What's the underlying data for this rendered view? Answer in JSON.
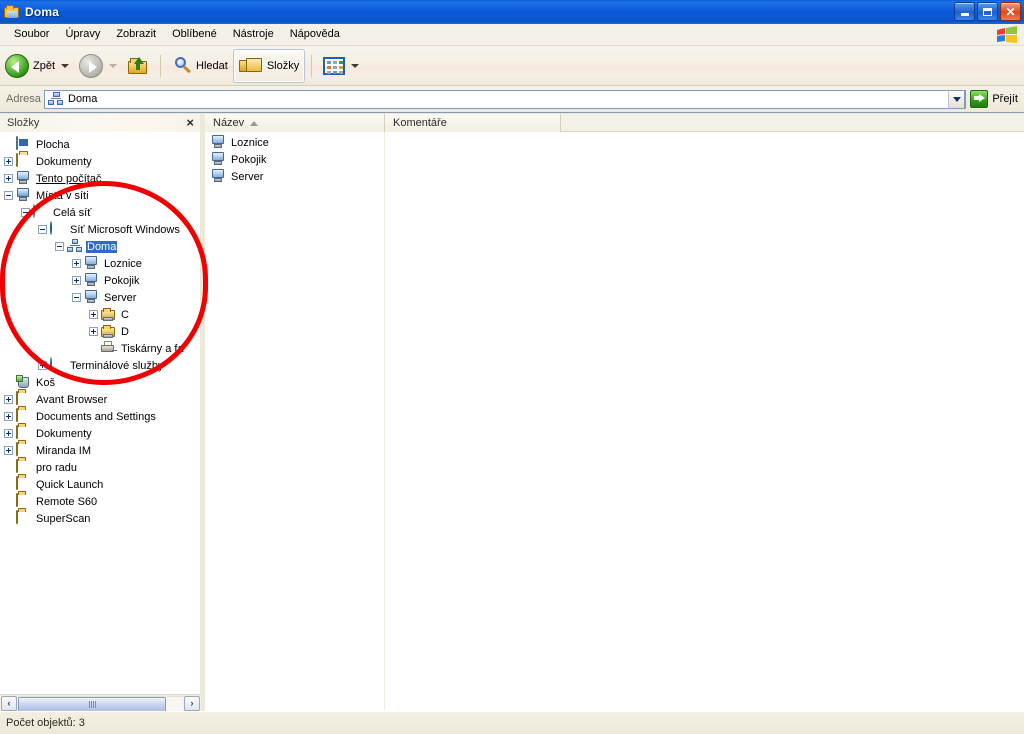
{
  "window": {
    "title": "Doma",
    "title_icon": "network-folder-icon",
    "buttons": {
      "minimize": "minimize-button",
      "maximize": "restore-button",
      "close": "close-button"
    }
  },
  "menubar": {
    "items": [
      {
        "label": "Soubor"
      },
      {
        "label": "Úpravy"
      },
      {
        "label": "Zobrazit"
      },
      {
        "label": "Oblíbené"
      },
      {
        "label": "Nástroje"
      },
      {
        "label": "Nápověda"
      }
    ],
    "logo": "windows-flag-logo"
  },
  "toolbar": {
    "back_label": "Zpět",
    "forward_label": "",
    "up_label": "",
    "search_label": "Hledat",
    "folders_label": "Složky",
    "views_label": "",
    "folders_pressed": true,
    "forward_disabled": true
  },
  "address": {
    "label": "Adresa",
    "value": "Doma",
    "icon": "network-workgroup-icon",
    "go_label": "Přejít"
  },
  "folders_panel": {
    "title": "Složky",
    "close": "×",
    "tree": [
      {
        "indent": 0,
        "expander": "none",
        "icon": "desktop-icon",
        "label": "Plocha",
        "selected": false,
        "underline": false
      },
      {
        "indent": 0,
        "expander": "plus",
        "icon": "documents-folder-icon",
        "label": "Dokumenty",
        "selected": false,
        "underline": false
      },
      {
        "indent": 0,
        "expander": "plus",
        "icon": "my-computer-icon",
        "label": "Tento počítač",
        "selected": false,
        "underline": true
      },
      {
        "indent": 0,
        "expander": "minus",
        "icon": "network-places-icon",
        "label": "Místa v síti",
        "selected": false,
        "underline": false
      },
      {
        "indent": 1,
        "expander": "minus",
        "icon": "entire-network-icon",
        "label": "Celá síť",
        "selected": false,
        "underline": false
      },
      {
        "indent": 2,
        "expander": "minus",
        "icon": "ms-windows-network-icon",
        "label": "Síť Microsoft Windows",
        "selected": false,
        "underline": false
      },
      {
        "indent": 3,
        "expander": "minus",
        "icon": "workgroup-icon",
        "label": "Doma",
        "selected": true,
        "underline": false
      },
      {
        "indent": 4,
        "expander": "plus",
        "icon": "computer-icon",
        "label": "Loznice",
        "selected": false,
        "underline": false
      },
      {
        "indent": 4,
        "expander": "plus",
        "icon": "computer-icon",
        "label": "Pokojik",
        "selected": false,
        "underline": false
      },
      {
        "indent": 4,
        "expander": "minus",
        "icon": "computer-icon",
        "label": "Server",
        "selected": false,
        "underline": false
      },
      {
        "indent": 5,
        "expander": "plus",
        "icon": "shared-drive-icon",
        "label": "C",
        "selected": false,
        "underline": false
      },
      {
        "indent": 5,
        "expander": "plus",
        "icon": "shared-drive-icon",
        "label": "D",
        "selected": false,
        "underline": false
      },
      {
        "indent": 5,
        "expander": "none",
        "icon": "printers-faxes-icon",
        "label": "Tiskárny a fa",
        "selected": false,
        "underline": false
      },
      {
        "indent": 2,
        "expander": "plus",
        "icon": "terminal-services-icon",
        "label": "Terminálové služby",
        "selected": false,
        "underline": false
      },
      {
        "indent": 0,
        "expander": "none",
        "icon": "recycle-bin-icon",
        "label": "Koš",
        "selected": false,
        "underline": false
      },
      {
        "indent": 0,
        "expander": "plus",
        "icon": "folder-icon",
        "label": "Avant Browser",
        "selected": false,
        "underline": false
      },
      {
        "indent": 0,
        "expander": "plus",
        "icon": "folder-icon",
        "label": "Documents and Settings",
        "selected": false,
        "underline": false
      },
      {
        "indent": 0,
        "expander": "plus",
        "icon": "folder-icon",
        "label": "Dokumenty",
        "selected": false,
        "underline": false
      },
      {
        "indent": 0,
        "expander": "plus",
        "icon": "folder-icon",
        "label": "Miranda IM",
        "selected": false,
        "underline": false
      },
      {
        "indent": 0,
        "expander": "none",
        "icon": "folder-icon",
        "label": "pro radu",
        "selected": false,
        "underline": false
      },
      {
        "indent": 0,
        "expander": "none",
        "icon": "folder-icon",
        "label": "Quick Launch",
        "selected": false,
        "underline": false
      },
      {
        "indent": 0,
        "expander": "none",
        "icon": "folder-icon",
        "label": "Remote S60",
        "selected": false,
        "underline": false
      },
      {
        "indent": 0,
        "expander": "none",
        "icon": "folder-icon",
        "label": "SuperScan",
        "selected": false,
        "underline": false
      }
    ],
    "scrollbar": {
      "left_arrow": "‹",
      "right_arrow": "›"
    }
  },
  "annotation": {
    "shape": "red-ellipse",
    "color": "#f20000"
  },
  "list_view": {
    "columns": [
      {
        "label": "Název",
        "sorted": "asc"
      },
      {
        "label": "Komentáře",
        "sorted": "none"
      }
    ],
    "rows": [
      {
        "icon": "computer-icon",
        "name": "Loznice",
        "comment": ""
      },
      {
        "icon": "computer-icon",
        "name": "Pokojik",
        "comment": ""
      },
      {
        "icon": "computer-icon",
        "name": "Server",
        "comment": ""
      }
    ]
  },
  "statusbar": {
    "text": "Počet objektů: 3"
  }
}
